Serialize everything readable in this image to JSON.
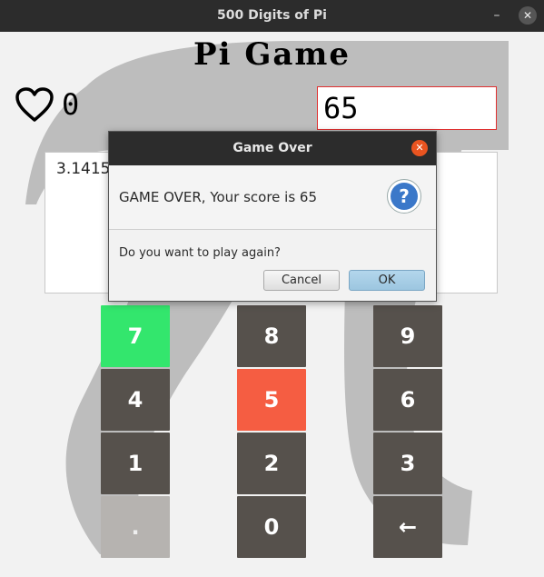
{
  "window": {
    "title": "500 Digits of Pi",
    "minimize_glyph": "–",
    "close_glyph": "✕"
  },
  "game": {
    "title": "Pi Game",
    "lives": "0",
    "score_display": "65",
    "digits_text": "3.1415",
    "icons": {
      "lives": "heart-icon",
      "background": "pi-symbol"
    }
  },
  "keypad": {
    "keys": [
      {
        "label": "7",
        "state": "correct",
        "color": "#33e66d"
      },
      {
        "label": "8",
        "state": "normal",
        "color": "#56514c"
      },
      {
        "label": "9",
        "state": "normal",
        "color": "#56514c"
      },
      {
        "label": "4",
        "state": "normal",
        "color": "#56514c"
      },
      {
        "label": "5",
        "state": "wrong",
        "color": "#f55d42"
      },
      {
        "label": "6",
        "state": "normal",
        "color": "#56514c"
      },
      {
        "label": "1",
        "state": "normal",
        "color": "#56514c"
      },
      {
        "label": "2",
        "state": "normal",
        "color": "#56514c"
      },
      {
        "label": "3",
        "state": "normal",
        "color": "#56514c"
      },
      {
        "label": ".",
        "state": "disabled",
        "color": "#b6b3b0"
      },
      {
        "label": "0",
        "state": "normal",
        "color": "#56514c"
      },
      {
        "label": "←",
        "state": "normal",
        "color": "#56514c"
      }
    ]
  },
  "dialog": {
    "title": "Game Over",
    "close_glyph": "✕",
    "header_text": "GAME OVER, Your score is 65",
    "icon": "question-icon",
    "icon_glyph": "?",
    "content_text": "Do you want to play again?",
    "cancel_label": "Cancel",
    "ok_label": "OK",
    "accent": "#e95420"
  }
}
